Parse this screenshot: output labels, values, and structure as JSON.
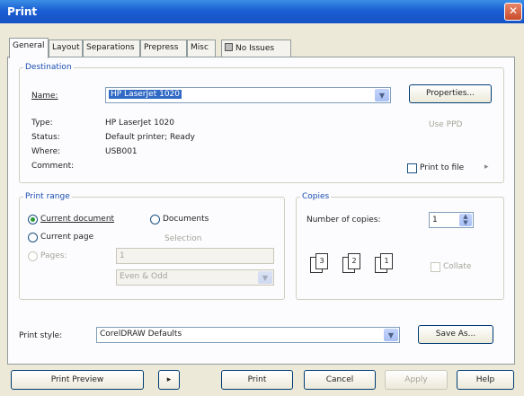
{
  "window": {
    "title": "Print",
    "close_glyph": "✕"
  },
  "tabs": [
    {
      "label": "General"
    },
    {
      "label": "Layout"
    },
    {
      "label": "Separations"
    },
    {
      "label": "Prepress"
    },
    {
      "label": "Misc"
    },
    {
      "label": "No Issues"
    }
  ],
  "destination": {
    "legend": "Destination",
    "name_label": "Name:",
    "name_value": "HP LaserJet 1020",
    "properties_button": "Properties...",
    "type_label": "Type:",
    "type_value": "HP LaserJet 1020",
    "status_label": "Status:",
    "status_value": "Default printer; Ready",
    "where_label": "Where:",
    "where_value": "USB001",
    "comment_label": "Comment:",
    "use_ppd_label": "Use PPD",
    "print_to_file_label": "Print to file",
    "print_to_file_arrow": "▸"
  },
  "print_range": {
    "legend": "Print range",
    "current_document": "Current document",
    "documents": "Documents",
    "current_page": "Current page",
    "selection": "Selection",
    "pages_label": "Pages:",
    "pages_value": "1",
    "pages_filter": "Even & Odd"
  },
  "copies": {
    "legend": "Copies",
    "number_label": "Number of copies:",
    "number_value": "1",
    "collate_label": "Collate"
  },
  "print_style": {
    "label": "Print style:",
    "value": "CorelDRAW Defaults",
    "save_as_button": "Save As..."
  },
  "footer": {
    "print_preview": "Print Preview",
    "preview_toggle": "▸",
    "print": "Print",
    "cancel": "Cancel",
    "apply": "Apply",
    "help": "Help"
  }
}
